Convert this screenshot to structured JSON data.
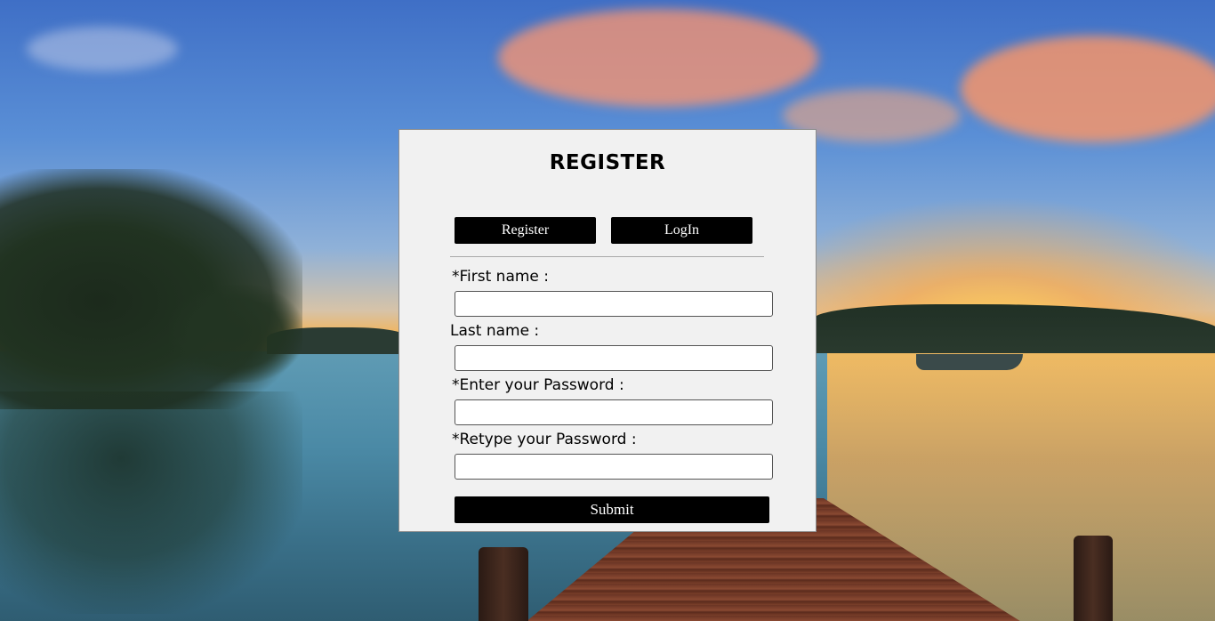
{
  "background": {
    "scene": "lakeside-sunset-with-wooden-pier"
  },
  "form": {
    "title": "REGISTER",
    "tabs": {
      "register_label": "Register",
      "login_label": "LogIn"
    },
    "fields": [
      {
        "label": "*First name :",
        "value": "",
        "type": "text"
      },
      {
        "label": "Last name :",
        "value": "",
        "type": "text"
      },
      {
        "label": "*Enter your Password :",
        "value": "",
        "type": "password"
      },
      {
        "label": "*Retype your Password :",
        "value": "",
        "type": "password"
      }
    ],
    "submit_label": "Submit"
  },
  "colors": {
    "panel_bg": "#f1f1f1",
    "button_bg": "#000000",
    "button_text": "#ffffff"
  }
}
